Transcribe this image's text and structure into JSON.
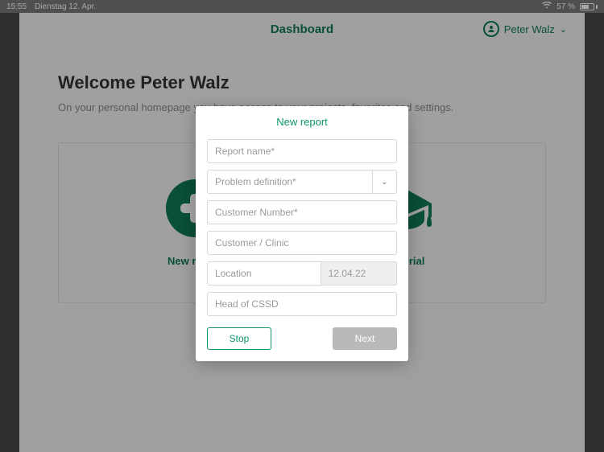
{
  "status": {
    "time": "15:55",
    "date": "Dienstag 12. Apr.",
    "battery": "57 %"
  },
  "header": {
    "title": "Dashboard",
    "user": "Peter Walz"
  },
  "page": {
    "welcome": "Welcome Peter Walz",
    "subtext": "On your personal homepage you have access to your projects, favorites and settings."
  },
  "tiles": {
    "new_report": "New report",
    "tutorial": "Tutorial"
  },
  "modal": {
    "title": "New report",
    "placeholders": {
      "report_name": "Report name*",
      "problem_def": "Problem definition*",
      "customer_no": "Customer Number*",
      "customer": "Customer / Clinic",
      "location": "Location",
      "head": "Head of CSSD"
    },
    "date": "12.04.22",
    "buttons": {
      "stop": "Stop",
      "next": "Next"
    }
  }
}
